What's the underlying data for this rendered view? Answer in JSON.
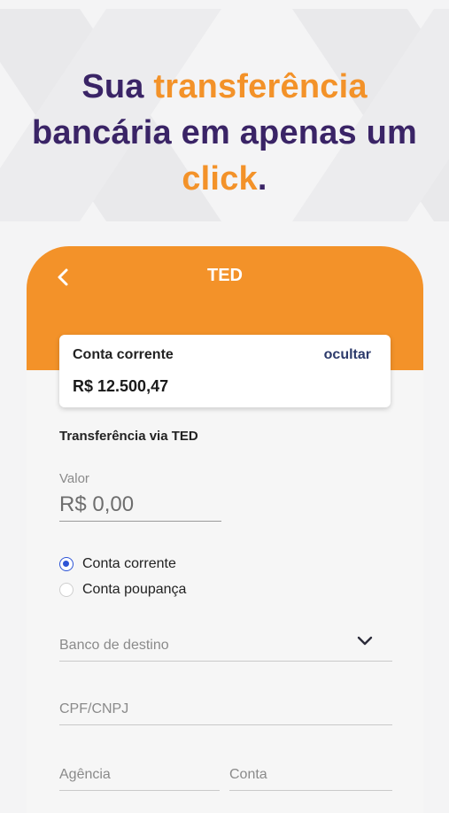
{
  "headline": {
    "part1": "Sua ",
    "highlight1": "transferência",
    "part2": "bancária em apenas um",
    "highlight2": "click",
    "part3": "."
  },
  "screen": {
    "title": "TED",
    "back_icon": "chevron-left-icon"
  },
  "balance": {
    "label": "Conta corrente",
    "hide_link": "ocultar",
    "value": "R$ 12.500,47"
  },
  "form": {
    "section_title": "Transferência via TED",
    "valor_label": "Valor",
    "valor_value": "R$ 0,00",
    "radio_options": [
      {
        "label": "Conta corrente",
        "selected": true
      },
      {
        "label": "Conta poupança",
        "selected": false
      }
    ],
    "bank_placeholder": "Banco de destino",
    "cpf_placeholder": "CPF/CNPJ",
    "agencia_placeholder": "Agência",
    "conta_placeholder": "Conta"
  },
  "colors": {
    "accent": "#f39229",
    "brand_dark": "#3a2466",
    "radio": "#2e55d6",
    "link": "#2c3a6b"
  }
}
